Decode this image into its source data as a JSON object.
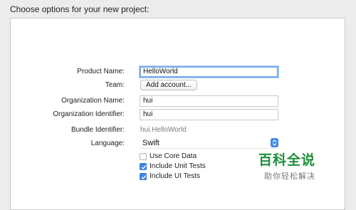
{
  "dialog": {
    "heading": "Choose options for your new project:"
  },
  "form": {
    "product_name": {
      "label": "Product Name:",
      "value": "HelloWorld"
    },
    "team": {
      "label": "Team:",
      "button": "Add account..."
    },
    "organization_name": {
      "label": "Organization Name:",
      "value": "hui"
    },
    "organization_identifier": {
      "label": "Organization Identifier:",
      "value": "hui"
    },
    "bundle_identifier": {
      "label": "Bundle Identifier:",
      "value": "hui.HelloWorld"
    },
    "language": {
      "label": "Language:",
      "value": "Swift",
      "icon": "chevron-updown-icon"
    },
    "options": [
      {
        "label": "Use Core Data",
        "checked": false
      },
      {
        "label": "Include Unit Tests",
        "checked": true
      },
      {
        "label": "Include UI Tests",
        "checked": true
      }
    ]
  },
  "watermark": {
    "title": "百科全说",
    "subtitle": "助你轻松解决"
  },
  "colors": {
    "accent": "#3d8ae6",
    "focus_ring": "#79abe8",
    "watermark_green": "#1e8f3b",
    "background": "#ececec",
    "panel": "#ffffff"
  }
}
